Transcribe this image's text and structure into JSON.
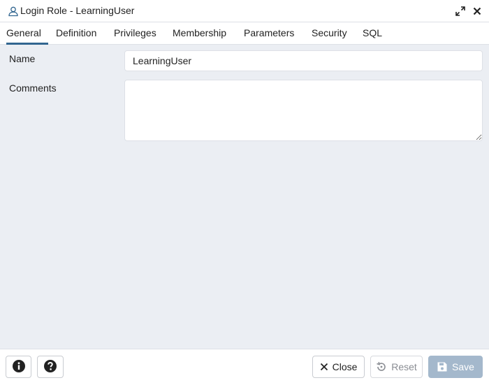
{
  "window": {
    "title": "Login Role - LearningUser",
    "title_icon": "user-icon",
    "maximize_icon": "expand-icon",
    "close_icon": "close-icon"
  },
  "tabs": [
    {
      "label": "General",
      "active": true
    },
    {
      "label": "Definition",
      "active": false
    },
    {
      "label": "Privileges",
      "active": false
    },
    {
      "label": "Membership",
      "active": false
    },
    {
      "label": "Parameters",
      "active": false
    },
    {
      "label": "Security",
      "active": false
    },
    {
      "label": "SQL",
      "active": false
    }
  ],
  "form": {
    "name_label": "Name",
    "name_value": "LearningUser",
    "comments_label": "Comments",
    "comments_value": ""
  },
  "footer": {
    "info_icon": "info-icon",
    "help_icon": "help-icon",
    "close_label": "Close",
    "close_icon": "close-icon",
    "reset_label": "Reset",
    "reset_icon": "reset-icon",
    "save_label": "Save",
    "save_icon": "save-icon"
  },
  "colors": {
    "accent": "#326690",
    "content_bg": "#ebeef3",
    "save_disabled_bg": "#a4b8cc"
  }
}
